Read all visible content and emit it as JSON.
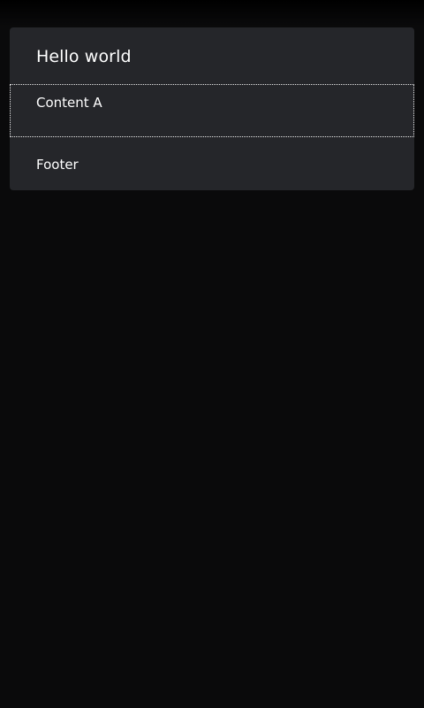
{
  "card": {
    "title": "Hello world",
    "content": "Content A",
    "footer": "Footer"
  },
  "colors": {
    "background": "#0a0a0b",
    "card_background": "#25262a",
    "text": "#ffffff",
    "focus_outline": "#e8e8e8"
  }
}
